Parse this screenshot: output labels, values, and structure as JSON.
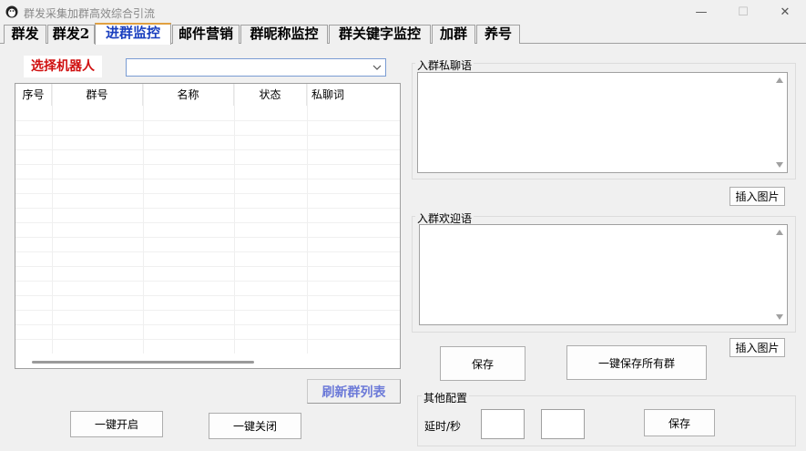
{
  "window": {
    "title": "群发采集加群高效综合引流",
    "minimize": "—",
    "maximize": "☐",
    "close": "✕"
  },
  "tabs": [
    {
      "label": "群发"
    },
    {
      "label": "群发2"
    },
    {
      "label": "进群监控",
      "active": true
    },
    {
      "label": "邮件营销"
    },
    {
      "label": "群昵称监控"
    },
    {
      "label": "群关键字监控"
    },
    {
      "label": "加群"
    },
    {
      "label": "养号"
    }
  ],
  "robot": {
    "label": "选择机器人",
    "selected": ""
  },
  "table": {
    "columns": [
      "序号",
      "群号",
      "名称",
      "状态",
      "私聊词"
    ],
    "rows": []
  },
  "left_buttons": {
    "refresh": "刷新群列表",
    "start_all": "一键开启",
    "close_all": "一键关闭"
  },
  "private_msg": {
    "title": "入群私聊语",
    "value": "",
    "insert_image": "插入图片"
  },
  "welcome_msg": {
    "title": "入群欢迎语",
    "value": "",
    "insert_image": "插入图片"
  },
  "save_buttons": {
    "save": "保存",
    "save_all": "一键保存所有群"
  },
  "other_config": {
    "title": "其他配置",
    "delay_label": "延时/秒",
    "delay_min": "",
    "delay_max": "",
    "save": "保存"
  },
  "colors": {
    "active_tab_text": "#1a3fbf",
    "robot_label": "#d01010",
    "refresh_text": "#6c7ad8"
  }
}
